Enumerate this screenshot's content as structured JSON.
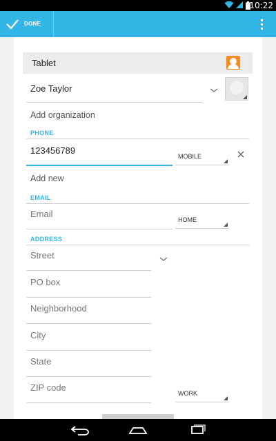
{
  "status_bar": {
    "time": "10:22"
  },
  "action_bar": {
    "done_label": "DONE"
  },
  "account": {
    "label": "Tablet"
  },
  "name": {
    "value": "Zoe Taylor"
  },
  "organization": {
    "label": "Add organization"
  },
  "phone": {
    "section_title": "PHONE",
    "value": "123456789",
    "type": "MOBILE",
    "add_label": "Add new"
  },
  "email": {
    "section_title": "EMAIL",
    "placeholder": "Email",
    "type": "HOME"
  },
  "address": {
    "section_title": "ADDRESS",
    "street_placeholder": "Street",
    "pobox_placeholder": "PO box",
    "neighborhood_placeholder": "Neighborhood",
    "city_placeholder": "City",
    "state_placeholder": "State",
    "zip_placeholder": "ZIP code",
    "type": "WORK"
  },
  "colors": {
    "accent": "#33b5e5",
    "account_icon": "#f48b1f"
  },
  "icons": [
    "checkmark-icon",
    "overflow-menu-icon",
    "wifi-icon",
    "signal-icon",
    "battery-icon",
    "account-icon",
    "chevron-down-icon",
    "close-icon",
    "back-icon",
    "home-icon",
    "recent-apps-icon"
  ]
}
